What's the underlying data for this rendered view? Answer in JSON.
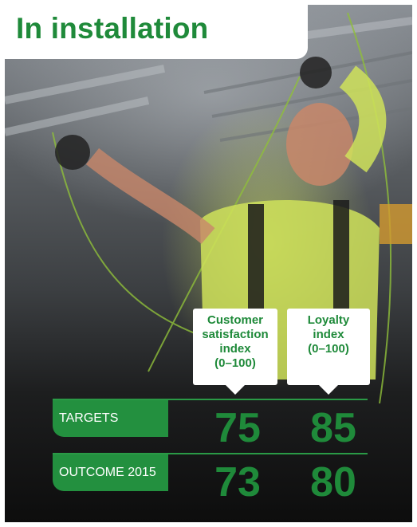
{
  "title": "In installation",
  "columns": [
    {
      "lines": [
        "Customer",
        "satisfaction",
        "index",
        "(0–100)"
      ]
    },
    {
      "lines": [
        "Loyalty",
        "index",
        "(0–100)"
      ]
    }
  ],
  "rows": [
    {
      "label": "TARGETS",
      "values": [
        "75",
        "85"
      ]
    },
    {
      "label": "OUTCOME 2015",
      "values": [
        "73",
        "80"
      ]
    }
  ],
  "colors": {
    "accent_green": "#1f8a3a",
    "label_bg": "#23903f",
    "shirt_yellow": "#d7eb5f"
  },
  "image": {
    "description_icon": "worker-installing-cables-photo"
  }
}
